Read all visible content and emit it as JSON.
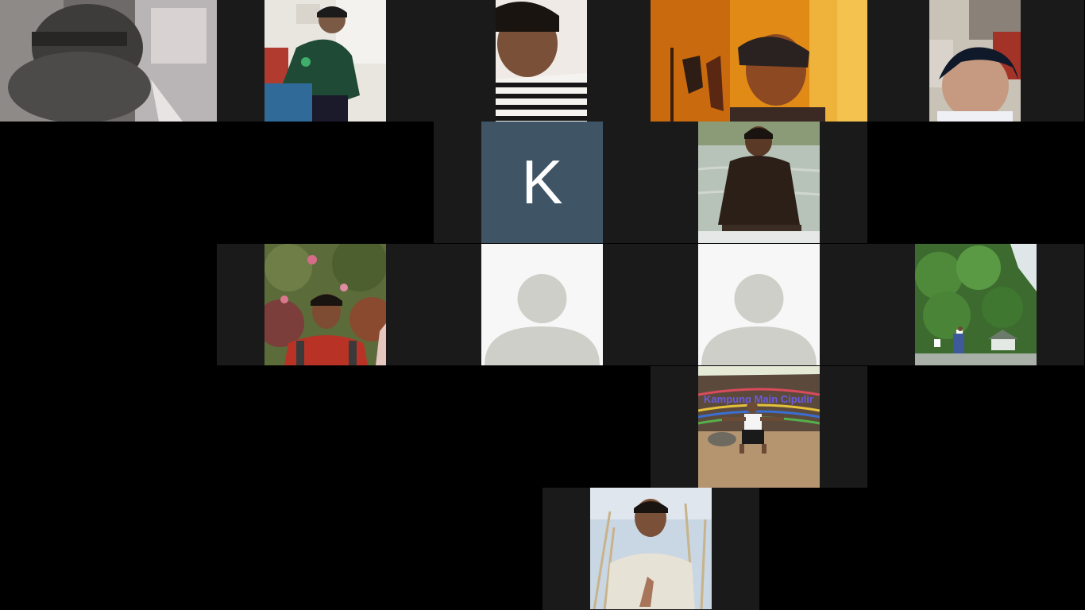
{
  "meeting": {
    "participants": [
      {
        "id": "p1",
        "type": "video",
        "scene": "blurred-dark"
      },
      {
        "id": "p2",
        "type": "video",
        "scene": "green-jacket-glasses"
      },
      {
        "id": "p3",
        "type": "video",
        "scene": "striped-shirt"
      },
      {
        "id": "p4",
        "type": "video",
        "scene": "orange-room"
      },
      {
        "id": "p5",
        "type": "video",
        "scene": "dark-hair-closeup"
      },
      {
        "id": "p6",
        "type": "initial",
        "initial": "K"
      },
      {
        "id": "p7",
        "type": "video",
        "scene": "lake-brown-shirt"
      },
      {
        "id": "p8",
        "type": "video",
        "scene": "red-shirt-garden"
      },
      {
        "id": "p9",
        "type": "avatar-placeholder"
      },
      {
        "id": "p10",
        "type": "avatar-placeholder"
      },
      {
        "id": "p11",
        "type": "video",
        "scene": "forest-path"
      },
      {
        "id": "p12",
        "type": "video",
        "scene": "kampung-main-cipulir",
        "sign_text": "Kampung Main Cipulir"
      },
      {
        "id": "p13",
        "type": "video",
        "scene": "peace-sign-field"
      }
    ]
  },
  "colors": {
    "background": "#000000",
    "tile": "#1a1a1a",
    "initial_bg": "#3f5566",
    "placeholder_bg": "#f7f7f7",
    "placeholder_silhouette": "#cfcfc9"
  }
}
